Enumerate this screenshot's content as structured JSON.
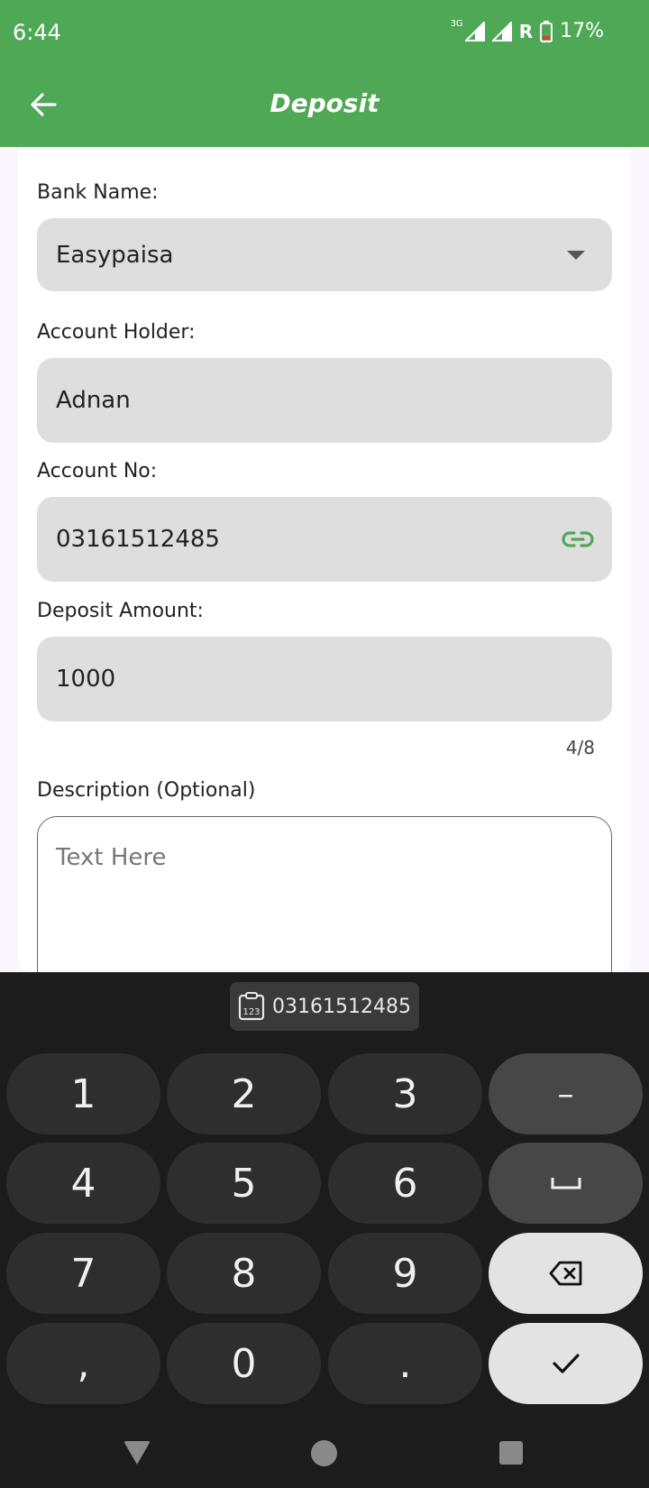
{
  "status_bar": {
    "time": "6:44",
    "network": "3G",
    "roaming": "R",
    "battery": "17%"
  },
  "app_bar": {
    "title": "Deposit"
  },
  "form": {
    "bank_name_label": "Bank Name:",
    "bank_name_value": "Easypaisa",
    "account_holder_label": "Account Holder:",
    "account_holder_value": "Adnan",
    "account_no_label": "Account No:",
    "account_no_value": "03161512485",
    "deposit_amount_label": "Deposit Amount:",
    "deposit_amount_value": "1000",
    "deposit_amount_counter": "4/8",
    "description_label": "Description (Optional)",
    "description_placeholder": "Text Here"
  },
  "keyboard": {
    "clipboard_suggestion": "03161512485",
    "keys": {
      "k1": "1",
      "k2": "2",
      "k3": "3",
      "dash": "–",
      "k4": "4",
      "k5": "5",
      "k6": "6",
      "space": "␣",
      "k7": "7",
      "k8": "8",
      "k9": "9",
      "comma": ",",
      "k0": "0",
      "period": "."
    }
  },
  "colors": {
    "primary": "#4fa856",
    "field_bg": "#dedede",
    "keyboard_bg": "#1c1c1c"
  },
  "icons": {
    "back": "arrow-left-icon",
    "dropdown": "chevron-down-icon",
    "account_no_action": "link-icon",
    "clipboard": "clipboard-numbers-icon",
    "backspace": "backspace-icon",
    "done": "check-icon"
  }
}
